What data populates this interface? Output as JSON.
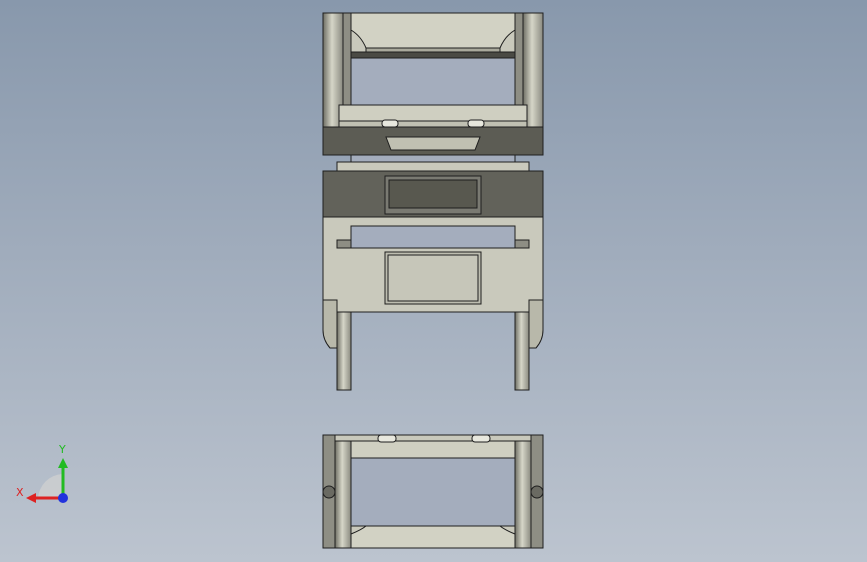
{
  "viewport": {
    "background_top": "#8898ac",
    "background_bottom": "#bcc4cf"
  },
  "model": {
    "body_color": "#c9c9bc",
    "body_shade": "#a9a99c",
    "dark_color": "#5c5c54",
    "edge_color": "#1e1e1e",
    "window_color": "#a4adbd"
  },
  "triad": {
    "y_label": "Y",
    "x_label": "X",
    "y_color": "#22bb22",
    "x_color": "#dd2222",
    "z_color": "#2233dd",
    "icons": [
      "view-orientation-triad-icon"
    ]
  }
}
